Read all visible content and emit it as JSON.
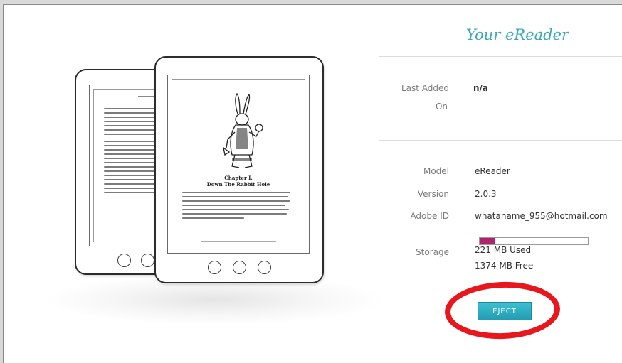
{
  "panel": {
    "title": "Your eReader"
  },
  "last_added": {
    "label_line1": "Last Added",
    "label_line2": "On",
    "value": "n/a"
  },
  "details": {
    "model_label": "Model",
    "model_value": "eReader",
    "version_label": "Version",
    "version_value": "2.0.3",
    "adobe_label": "Adobe ID",
    "adobe_value": "whataname_955@hotmail.com",
    "storage_label": "Storage",
    "storage_used": "221 MB Used",
    "storage_free": "1374 MB Free",
    "storage_used_fraction": 0.138
  },
  "eject": {
    "label": "EJECT"
  },
  "illustration": {
    "chapter_line1": "Chapter I.",
    "chapter_line2": "Down The Rabbit Hole"
  },
  "colors": {
    "title": "#3da8b8",
    "eject_button": "#2aaec2",
    "storage_fill": "#b0236e",
    "highlight": "#e8161d"
  }
}
